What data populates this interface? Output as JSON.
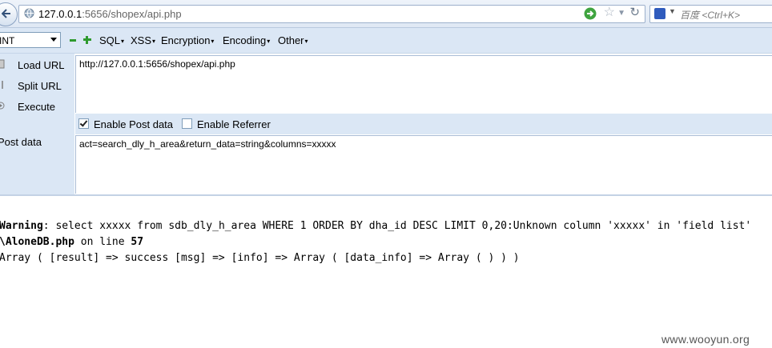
{
  "browser": {
    "url_host": "127.0.0.1",
    "url_rest": ":5656/shopex/api.php",
    "search_placeholder": "百度 <Ctrl+K>"
  },
  "hackbar": {
    "type_select": "INT",
    "menus": [
      "SQL",
      "XSS",
      "Encryption",
      "Encoding",
      "Other"
    ],
    "actions": {
      "load_url": "Load URL",
      "split_url": "Split URL",
      "execute": "Execute"
    },
    "url_value": "http://127.0.0.1:5656/shopex/api.php",
    "enable_post": "Enable Post data",
    "enable_post_checked": true,
    "enable_referrer": "Enable Referrer",
    "enable_referrer_checked": false,
    "post_label": "Post data",
    "post_value": "act=search_dly_h_area&return_data=string&columns=xxxxx"
  },
  "output": {
    "warning_label": "Warning",
    "warning_text": ": select xxxxx from sdb_dly_h_area WHERE 1 ORDER BY dha_id DESC LIMIT 0,20:Unknown column 'xxxxx' in 'field list'",
    "file": "\\AloneDB.php",
    "on_line": " on line ",
    "line_no": "57",
    "array_line": "Array ( [result] => success [msg] => [info] => Array ( [data_info] => Array ( ) ) )"
  },
  "watermark": "www.wooyun.org",
  "colors": {
    "toolbar_bg": "#dbe7f5",
    "accent_green": "#2e9a2e"
  }
}
